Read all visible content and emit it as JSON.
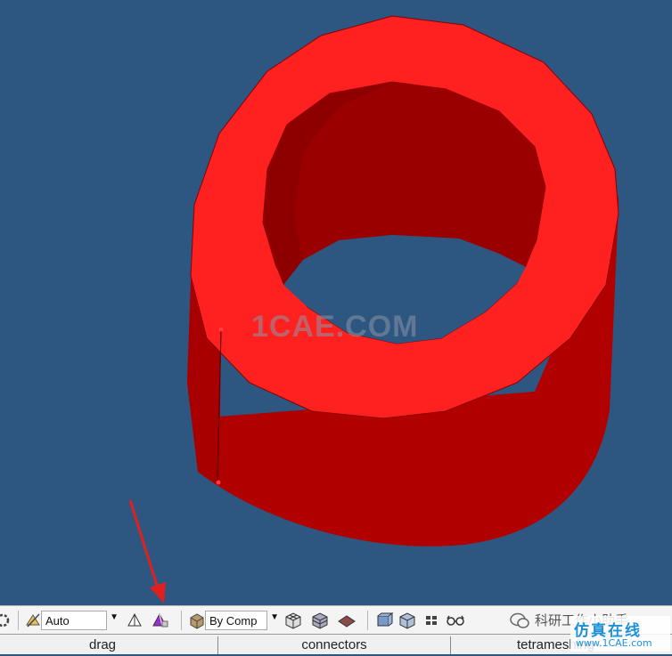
{
  "watermark": {
    "text": "1CAE.COM"
  },
  "toolbar": {
    "display_mode": "Auto",
    "color_mode": "By Comp"
  },
  "tabs": [
    {
      "label": "drag"
    },
    {
      "label": "connectors"
    },
    {
      "label": "tetrameshing"
    }
  ],
  "overlay": {
    "channel_name": "科研工作小助手",
    "logo_text": "仿真在线",
    "logo_url": "www.1CAE.com"
  },
  "colors": {
    "background": "#2d5680",
    "tube_top": "#ff2020",
    "tube_side": "#b20000",
    "annotation_arrow": "#e02020",
    "logo": "#1e90d8"
  }
}
